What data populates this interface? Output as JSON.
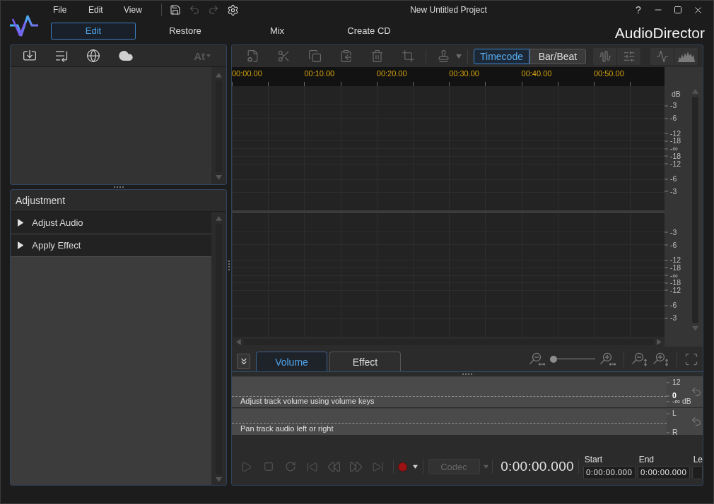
{
  "menu": [
    "File",
    "Edit",
    "View"
  ],
  "window": {
    "title": "New Untitled Project",
    "help": "?"
  },
  "modes": [
    {
      "label": "Edit",
      "selected": true
    },
    {
      "label": "Restore",
      "selected": false
    },
    {
      "label": "Mix",
      "selected": false
    },
    {
      "label": "Create CD",
      "selected": false
    }
  ],
  "brand": "AudioDirector",
  "library": {
    "text_size_button": {
      "label": "At",
      "disabled": true
    }
  },
  "adjustment": {
    "title": "Adjustment",
    "sections": [
      {
        "label": "Adjust Audio",
        "expanded": false
      },
      {
        "label": "Apply Effect",
        "expanded": false
      }
    ]
  },
  "editor": {
    "time_format": [
      {
        "label": "Timecode",
        "selected": true
      },
      {
        "label": "Bar/Beat",
        "selected": false
      }
    ],
    "ruler": [
      "00:00.00",
      "00:10.00",
      "00:20.00",
      "00:30.00",
      "00:40.00",
      "00:50.00"
    ],
    "tracks": [
      {
        "unit": "dB",
        "scale": [
          "-3",
          "-6",
          "-12",
          "-18",
          "-∞",
          "-18",
          "-12",
          "-6",
          "-3"
        ]
      },
      {
        "scale": [
          "-3",
          "-6",
          "-12",
          "-18",
          "-∞",
          "-18",
          "-12",
          "-6",
          "-3"
        ]
      }
    ]
  },
  "lane_tabs": [
    {
      "label": "Volume",
      "selected": true
    },
    {
      "label": "Effect",
      "selected": false
    }
  ],
  "zoom": {
    "level": 0
  },
  "lanes": [
    {
      "kind": "volume",
      "hint": "Adjust track volume using volume keys",
      "scale": [
        "12",
        "0",
        "-∞ dB"
      ]
    },
    {
      "kind": "pan",
      "hint": "Pan track audio left or right",
      "scale": [
        "L",
        "R"
      ]
    }
  ],
  "transport": {
    "codec": {
      "label": "Codec",
      "disabled": true
    },
    "time": "0:00:00.000",
    "fields": [
      {
        "label": "Start",
        "value": "0:00:00.000"
      },
      {
        "label": "End",
        "value": "0:00:00.000"
      },
      {
        "label": "Le"
      }
    ]
  }
}
